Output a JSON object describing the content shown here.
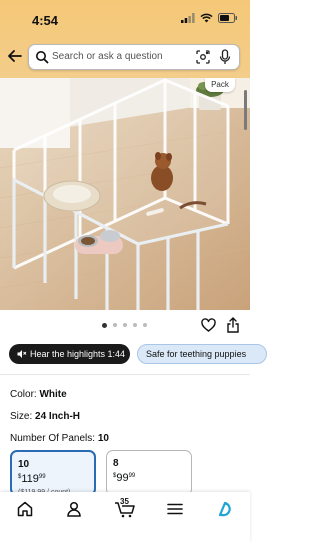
{
  "status": {
    "time": "4:54"
  },
  "search": {
    "placeholder": "Search or ask a question"
  },
  "product": {
    "badge": "Pack"
  },
  "carousel": {
    "count": 5,
    "active": 0
  },
  "chips": {
    "hear": "Hear the highlights 1:44",
    "safe": "Safe for teething puppies"
  },
  "attributes": {
    "color_label": "Color:",
    "color_value": "White",
    "size_label": "Size:",
    "size_value": "24 Inch-H",
    "panels_label": "Number Of Panels:",
    "panels_value": "10"
  },
  "options": [
    {
      "label": "10",
      "currency": "$",
      "dollars": "119",
      "cents": "99",
      "list_price": "($119.99 / count)"
    },
    {
      "label": "8",
      "currency": "$",
      "dollars": "99",
      "cents": "99"
    }
  ],
  "nav": {
    "cart_count": "35"
  },
  "colors": {
    "header": "#f5c878",
    "accent": "#2a6bb3",
    "alexa": "#1fa6d6"
  }
}
